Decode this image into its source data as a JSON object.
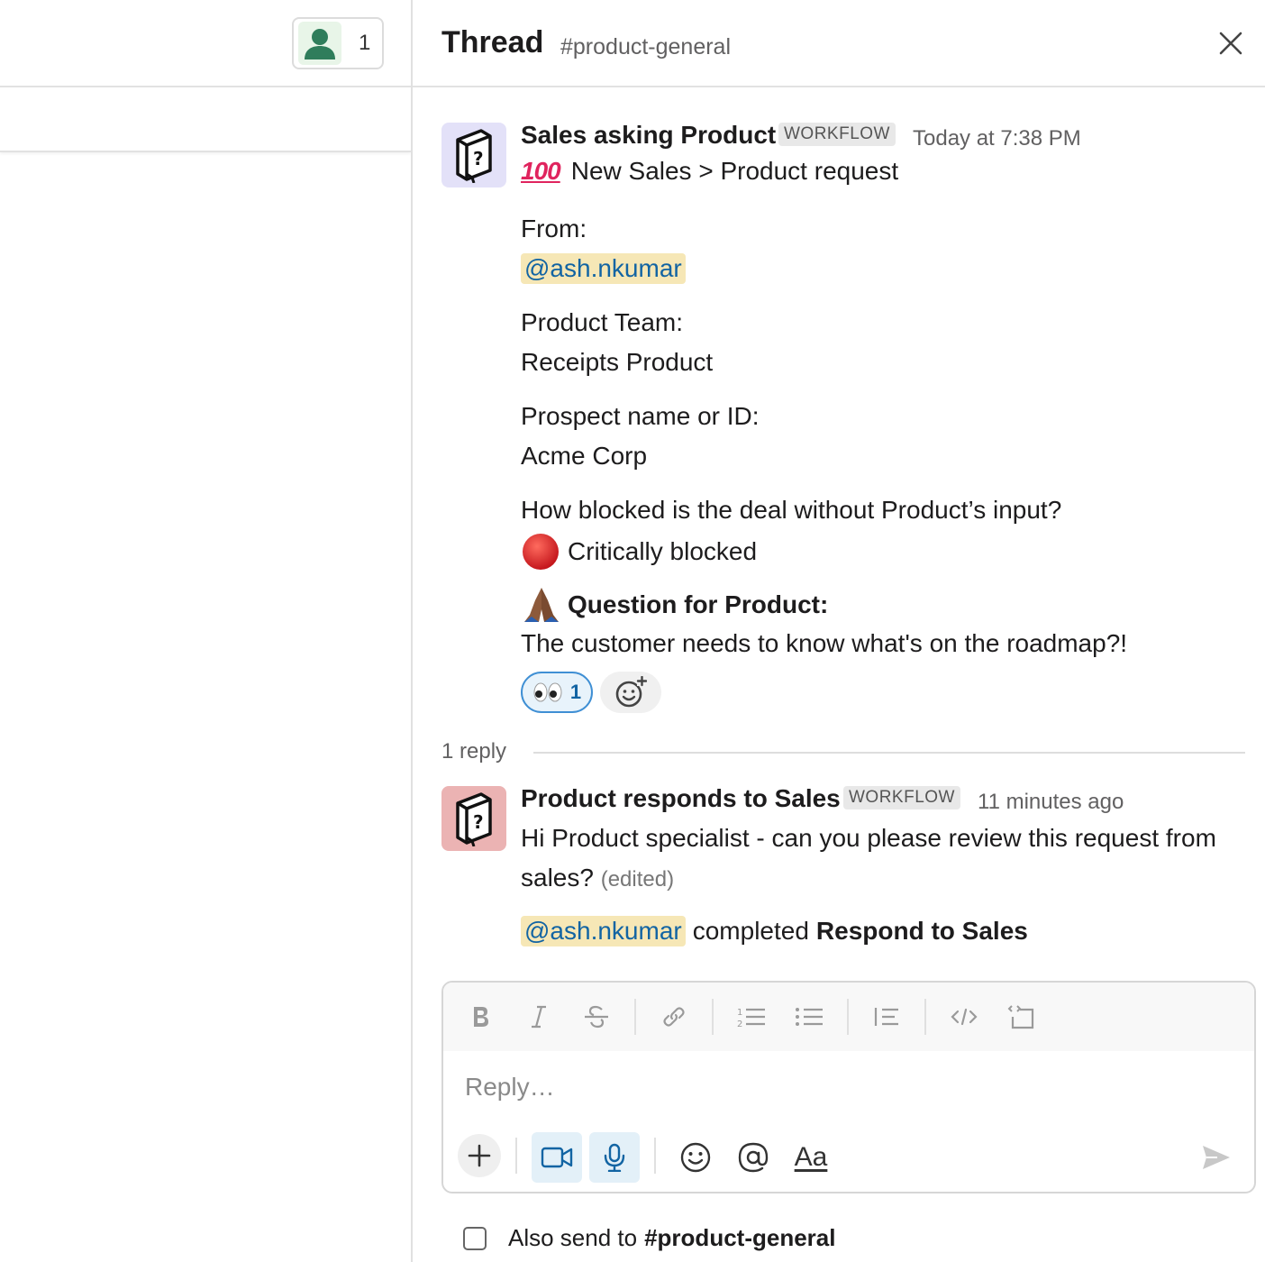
{
  "left": {
    "member_count": "1"
  },
  "thread": {
    "title": "Thread",
    "channel": "#product-general"
  },
  "message1": {
    "author": "Sales asking Product",
    "badge": "WORKFLOW",
    "time": "Today at 7:38 PM",
    "headline": "New Sales > Product request",
    "from_label": "From:",
    "from_mention": "@ash.nkumar",
    "team_label": "Product Team:",
    "team_value": "Receipts Product",
    "prospect_label": "Prospect name or ID:",
    "prospect_value": "Acme Corp",
    "blocked_label": "How blocked is the deal without Product’s input?",
    "blocked_value": "Critically blocked",
    "question_label": "Question for Product:",
    "question_value": "The customer needs to know what's on the roadmap?!",
    "reaction_count": "1"
  },
  "replies": {
    "label": "1 reply"
  },
  "message2": {
    "author": "Product responds to Sales",
    "badge": "WORKFLOW",
    "time": "11 minutes ago",
    "line1": "Hi Product specialist - can you please review this request from",
    "line2": "sales?",
    "edited": "(edited)",
    "mention": "@ash.nkumar",
    "completed": "completed",
    "task": "Respond to Sales"
  },
  "composer": {
    "placeholder": "Reply…",
    "format_label": "Aa"
  },
  "also_send": {
    "label": "Also send to",
    "channel": "#product-general"
  },
  "colors": {
    "mention_bg": "#f6e7b6",
    "mention_text": "#1264a3",
    "avatar1_bg": "#e3e1f8",
    "avatar2_bg": "#ebb3b3",
    "member_icon": "#2f7d5b",
    "reaction_border": "#3f8fd4"
  }
}
